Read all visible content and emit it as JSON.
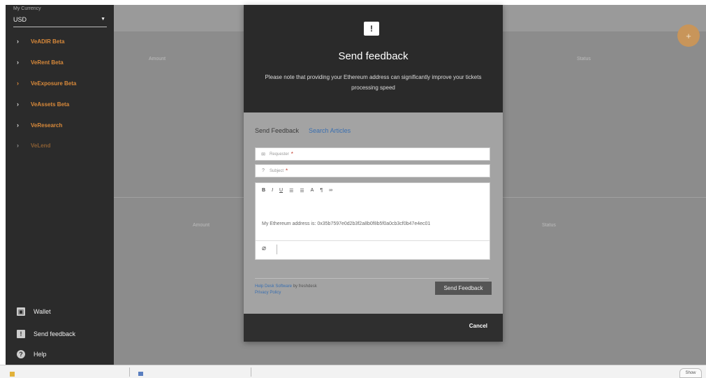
{
  "sidebar": {
    "currency_label": "My Currency",
    "currency_value": "USD",
    "items": [
      {
        "label": "VeADIR Beta"
      },
      {
        "label": "VeRent Beta"
      },
      {
        "label": "VeExposure Beta"
      },
      {
        "label": "VeAssets Beta"
      },
      {
        "label": "VeResearch"
      },
      {
        "label": "VeLend"
      }
    ],
    "bottom": [
      {
        "label": "Wallet",
        "icon": "wallet-icon"
      },
      {
        "label": "Send feedback",
        "icon": "feedback-icon"
      },
      {
        "label": "Help",
        "icon": "help-icon"
      }
    ]
  },
  "background": {
    "col_amount_1": "Amount",
    "col_status_1": "Status",
    "col_amount_2": "Amount",
    "col_status_2": "Status",
    "fab_label": "+"
  },
  "modal": {
    "icon": "!",
    "title": "Send feedback",
    "description": "Please note that providing your Ethereum address can significantly improve your tickets processing speed",
    "tabs": {
      "send": "Send Feedback",
      "search": "Search Articles"
    },
    "requester_placeholder": "Requester",
    "subject_placeholder": "Subject",
    "toolbar": [
      "B",
      "I",
      "U",
      "☰",
      "☰",
      "A",
      "¶",
      "∞"
    ],
    "editor_text": "My Ethereum address is: 0x35b7597e0d2b3f2a8b0f8b5f0a0cb3cf0b47e4ec01",
    "powered_link": "Help Desk Software",
    "powered_by": "by freshdesk",
    "privacy": "Privacy Policy",
    "send_button": "Send Feedback",
    "cancel": "Cancel"
  },
  "taskbar": {
    "right_label": "Show"
  },
  "colors": {
    "accent": "#d8893a",
    "sidebar_bg": "#2b2b2b",
    "modal_head": "#2a2a2a",
    "link": "#3a6fb0"
  }
}
